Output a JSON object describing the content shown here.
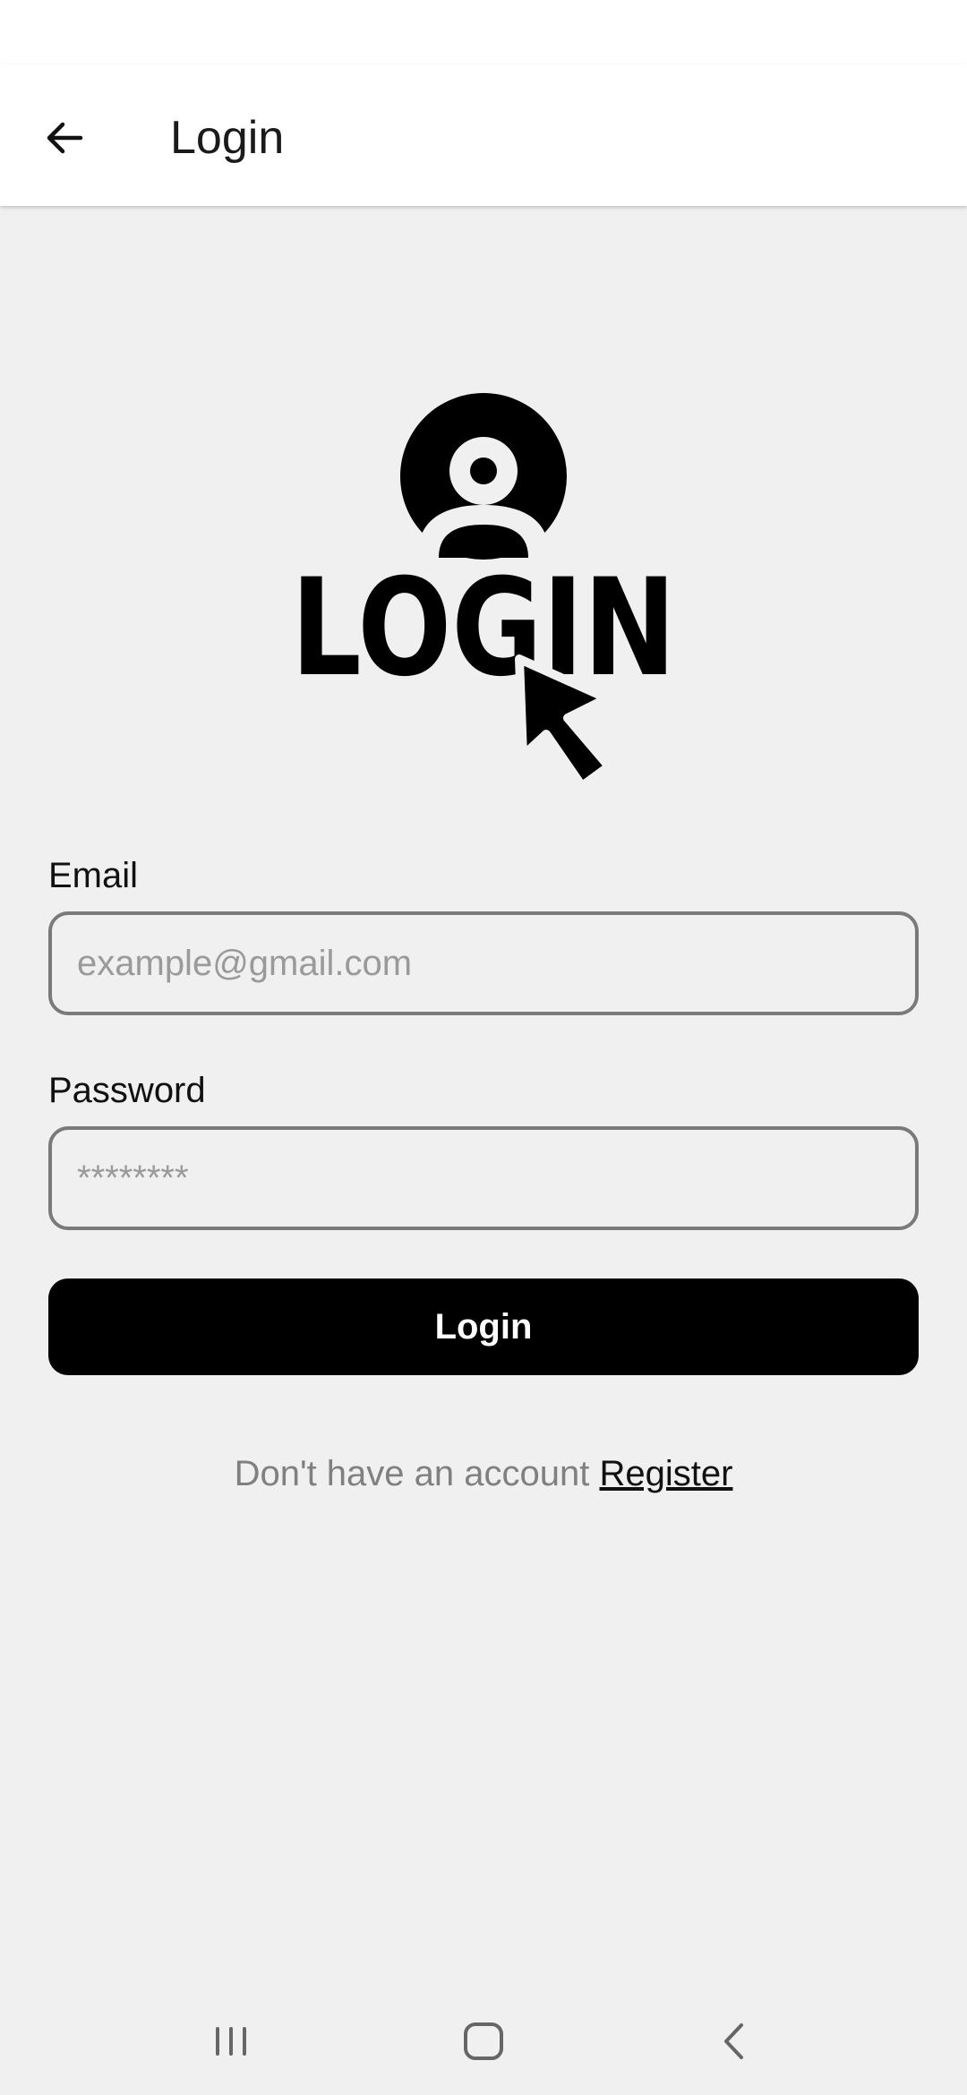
{
  "app_bar": {
    "title": "Login",
    "back_icon": "arrow-back-icon"
  },
  "logo": {
    "text": "LOGIN",
    "icon": "login-user-cursor-logo"
  },
  "form": {
    "email_label": "Email",
    "email_placeholder": "example@gmail.com",
    "email_value": "",
    "password_label": "Password",
    "password_placeholder": "********",
    "password_value": "",
    "login_button_label": "Login"
  },
  "register": {
    "prompt": "Don't have an account",
    "link_label": "Register"
  },
  "nav_bar": {
    "recents_icon": "recent-apps-icon",
    "home_icon": "home-icon",
    "back_icon": "system-back-icon"
  },
  "colors": {
    "background": "#f0f0f0",
    "app_bar": "#ffffff",
    "button": "#000000",
    "input_border": "#7a7a7a",
    "muted_text": "#808080"
  }
}
